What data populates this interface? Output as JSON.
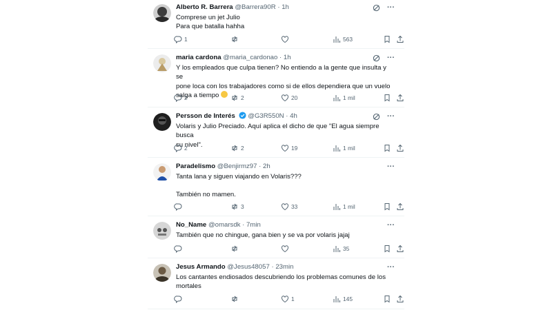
{
  "tweets": [
    {
      "name": "Alberto R. Barrera",
      "handle": "@Barrera90R",
      "time": "1h",
      "lines": [
        "Comprese un jet Julio",
        "Para que batalla hahha"
      ],
      "replies": "1",
      "reposts": "",
      "likes": "",
      "views": "563",
      "avatar_color": "#3d3d3d"
    },
    {
      "name": "maria cardona",
      "handle": "@maria_cardonao",
      "time": "1h",
      "lines": [
        "Y los empleados que culpa tienen? No entiendo a la gente que insulta y se",
        "pone loca con los trabajadores como si de ellos dependiera que un vuelo",
        "salga a tiempo"
      ],
      "replies": "2",
      "reposts": "2",
      "likes": "20",
      "views": "1 mil",
      "avatar_color": "#d9c9a0"
    },
    {
      "name": "Persson de Interés",
      "handle": "@G3R550N",
      "time": "4h",
      "lines": [
        "Volaris y Julio Preciado. Aquí aplica el dicho  de que \"El agua siempre busca",
        "su nivel\"."
      ],
      "replies": "2",
      "reposts": "2",
      "likes": "19",
      "views": "1 mil",
      "avatar_color": "#1f1f1f"
    },
    {
      "name": "Paradelismo",
      "handle": "@Benjirmz97",
      "time": "2h",
      "lines": [
        "Tanta lana y siguen viajando en Volaris???",
        "",
        "También no mamen."
      ],
      "replies": "",
      "reposts": "3",
      "likes": "33",
      "views": "1 mil",
      "avatar_color": "#1e4fa8"
    },
    {
      "name": "No_Name",
      "handle": "@omarsdk",
      "time": "7min",
      "lines": [
        "También que no chingue, gana bien y se va por volaris jajaj"
      ],
      "replies": "",
      "reposts": "",
      "likes": "",
      "views": "35",
      "avatar_color": "#8a8a8a"
    },
    {
      "name": "Jesus Armando",
      "handle": "@Jesus48057",
      "time": "23min",
      "lines": [
        "Los cantantes endiosados descubriendo los problemas comunes de los",
        "mortales"
      ],
      "replies": "",
      "reposts": "",
      "likes": "1",
      "views": "145",
      "avatar_color": "#6b5a44"
    }
  ],
  "colors": {
    "text": "#0f1419",
    "muted": "#536471",
    "verified": "#1d9bf0",
    "divider": "#eff3f4"
  },
  "icons": [
    "reply-icon",
    "repost-icon",
    "like-icon",
    "views-icon",
    "bookmark-icon",
    "share-icon",
    "grok-icon",
    "more-icon",
    "verified-badge-icon"
  ]
}
